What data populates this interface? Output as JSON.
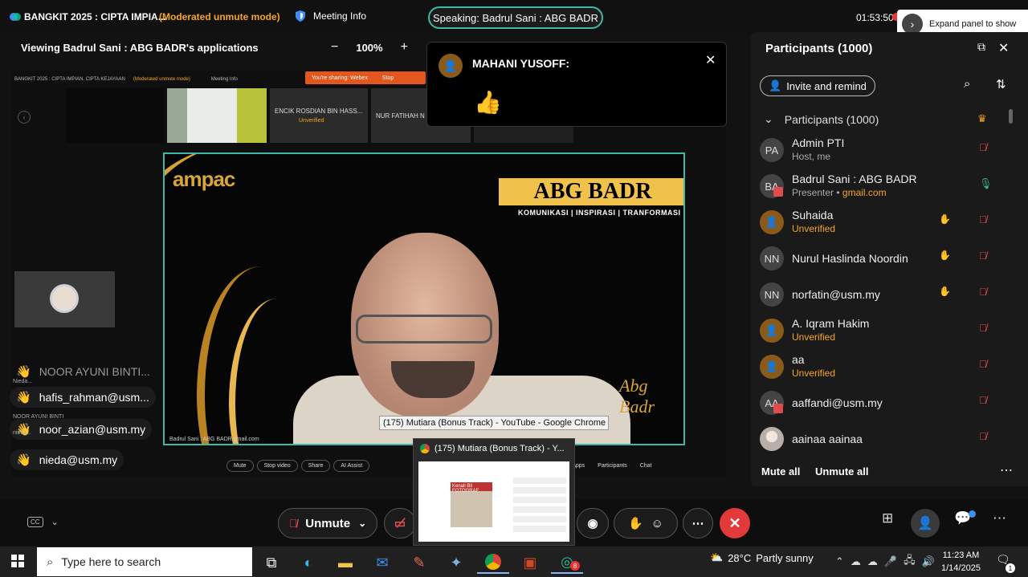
{
  "topbar": {
    "meeting_title": "BANGKIT 2025 : CIPTA IMPIA...",
    "unmute_mode": "(Moderated unmute mode)",
    "meeting_info": "Meeting Info",
    "speaking": "Speaking: Badrul Sani : ABG BADR",
    "clock": "01:53:50",
    "expand_panel": "Expand panel to show"
  },
  "viewing": {
    "label": "Viewing Badrul Sani : ABG BADR's applications",
    "zoom_minus": "−",
    "zoom_level": "100%",
    "zoom_plus": "+"
  },
  "shared": {
    "mini_title": "BANGKIT 2025 : CIPTA IMPIAN, CIPTA KEJAYAAN",
    "mini_mode": "(Moderated unmute mode)",
    "mini_info": "Meeting Info",
    "mini_sharing": "You're sharing: Webex",
    "mini_stop": "Stop",
    "thumb3_name": "ENCIK ROSDIAN BIN HASS...",
    "thumb3_status": "Unverified",
    "thumb4_name": "NUR FATIHAH N",
    "brand_ampac": "ampac",
    "brand_name": "ABG BADR",
    "brand_tagline": "KOMUNIKASI | INSPIRASI | TRANFORMASI",
    "stage_label": "Badrul Sani : ABG BADR gmail.com",
    "signature": "Abg Badr",
    "tooltip": "(175) Mutiara (Bonus Track) - YouTube - Google Chrome",
    "toolbar": {
      "mute": "Mute",
      "stop_video": "Stop video",
      "share": "Share",
      "ai_assist": "AI Assist",
      "apps": "Apps",
      "participants": "Participants",
      "chat": "Chat"
    }
  },
  "reactions": [
    {
      "name": "NOOR AYUNI BINTI..."
    },
    {
      "name": "hafis_rahman@usm..."
    },
    {
      "name": "noor_azian@usm.my"
    },
    {
      "name": "nieda@usm.my"
    }
  ],
  "reaction_small": {
    "line1": "Nieda...",
    "line2": "NOOR AYUNI BINTI",
    "line3": "nieda..."
  },
  "popup": {
    "name": "MAHANI YUSOFF:",
    "emoji": "👍",
    "close": "✕"
  },
  "panel": {
    "title": "Participants (1000)",
    "invite": "Invite and remind",
    "section": "Participants (1000)",
    "participants": [
      {
        "initials": "PA",
        "name": "Admin PTI",
        "sub": "Host, me"
      },
      {
        "initials": "BA",
        "name": "Badrul Sani : ABG BADR",
        "sub": "Presenter",
        "domain": "gmail.com"
      },
      {
        "initials": "",
        "name": "Suhaida",
        "sub": "Unverified"
      },
      {
        "initials": "NN",
        "name": "Nurul Haslinda Noordin",
        "sub": ""
      },
      {
        "initials": "NN",
        "name": "norfatin@usm.my",
        "sub": ""
      },
      {
        "initials": "",
        "name": "A. Iqram Hakim",
        "sub": "Unverified"
      },
      {
        "initials": "",
        "name": "aa",
        "sub": "Unverified"
      },
      {
        "initials": "AA",
        "name": "aaffandi@usm.my",
        "sub": ""
      },
      {
        "initials": "",
        "name": "aainaa aainaa",
        "sub": ""
      }
    ],
    "mute_all": "Mute all",
    "unmute_all": "Unmute all"
  },
  "controls": {
    "cc": "CC",
    "unmute": "Unmute"
  },
  "chrome_preview": {
    "title": "(175) Mutiara (Bonus Track) - Y...",
    "thumb_text": "Kenali Bil FOTOGRAF"
  },
  "taskbar": {
    "search": "Type here to search",
    "weather_temp": "28°C",
    "weather_desc": "Partly sunny",
    "time": "11:23 AM",
    "date": "1/14/2025",
    "webex_badge": "8",
    "notif_count": "1"
  }
}
